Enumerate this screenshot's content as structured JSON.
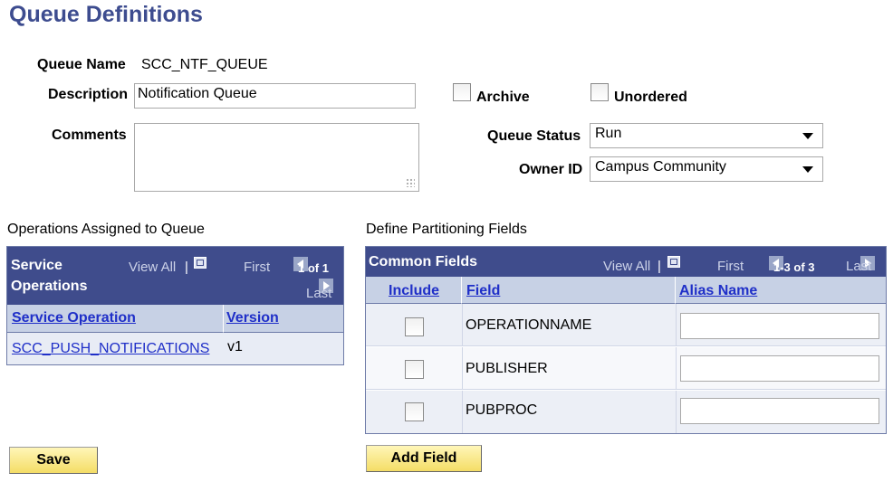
{
  "page": {
    "title": "Queue Definitions"
  },
  "form": {
    "queue_name_label": "Queue Name",
    "queue_name_value": "SCC_NTF_QUEUE",
    "description_label": "Description",
    "description_value": "Notification Queue",
    "comments_label": "Comments",
    "comments_value": "",
    "archive_label": "Archive",
    "archive_checked": false,
    "unordered_label": "Unordered",
    "unordered_checked": false,
    "queue_status_label": "Queue Status",
    "queue_status_value": "Run",
    "owner_id_label": "Owner ID",
    "owner_id_value": "Campus Community"
  },
  "operations": {
    "section_title": "Operations Assigned to Queue",
    "grid_title_line1": "Service",
    "grid_title_line2": "Operations",
    "view_all": "View All",
    "separator": "|",
    "first": "First",
    "count": "1 of 1",
    "last": "Last",
    "columns": [
      "Service Operation",
      "Version"
    ],
    "rows": [
      {
        "operation": "SCC_PUSH_NOTIFICATIONS",
        "version": "v1"
      }
    ]
  },
  "partition": {
    "section_title": "Define Partitioning Fields",
    "grid_title": "Common Fields",
    "view_all": "View All",
    "separator": "|",
    "first": "First",
    "count": "1-3 of 3",
    "last": "Last",
    "columns": [
      "Include",
      "Field",
      "Alias Name"
    ],
    "rows": [
      {
        "include": false,
        "field": "OPERATIONNAME",
        "alias": ""
      },
      {
        "include": false,
        "field": "PUBLISHER",
        "alias": ""
      },
      {
        "include": false,
        "field": "PUBPROC",
        "alias": ""
      }
    ]
  },
  "buttons": {
    "save": "Save",
    "add_field": "Add Field"
  },
  "colors": {
    "title": "#3d4c8f",
    "grid_header": "#3f4c8c",
    "column_header": "#c7d1e5",
    "link": "#1f2fc8",
    "button": "#f4dd66"
  }
}
